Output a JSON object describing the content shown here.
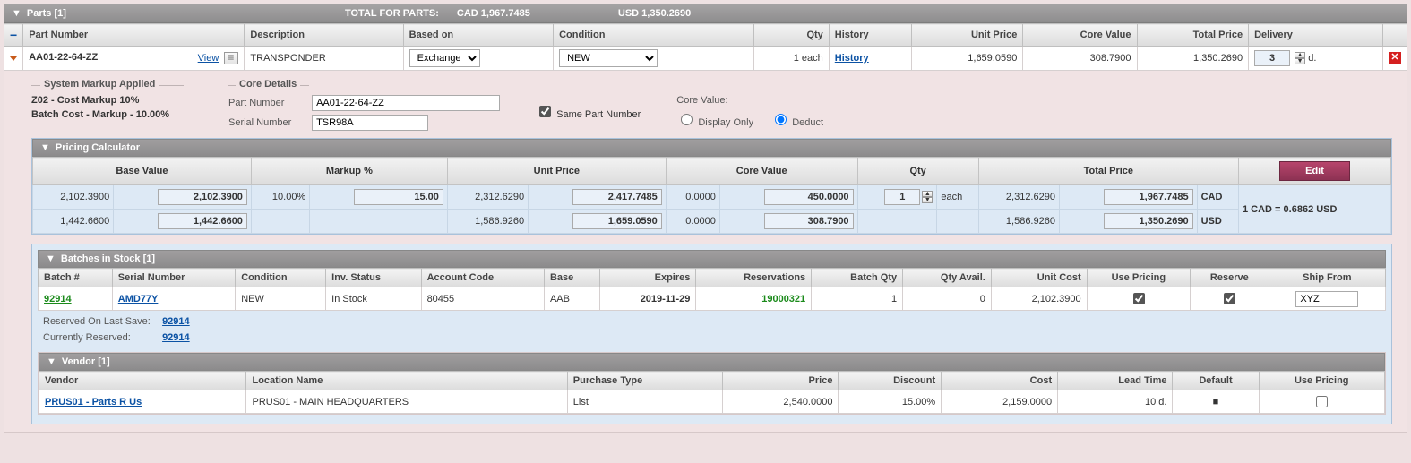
{
  "parts_header": {
    "title": "Parts [1]",
    "total_label": "TOTAL FOR PARTS:",
    "total_cad": "CAD 1,967.7485",
    "total_usd": "USD 1,350.2690"
  },
  "grid_cols": {
    "pn": "Part Number",
    "desc": "Description",
    "based": "Based on",
    "cond": "Condition",
    "qty": "Qty",
    "hist": "History",
    "unit": "Unit Price",
    "core": "Core Value",
    "total": "Total Price",
    "deliv": "Delivery"
  },
  "part_row": {
    "pn": "AA01-22-64-ZZ",
    "view": "View",
    "desc": "TRANSPONDER",
    "based": "Exchange",
    "cond": "NEW",
    "qty": "1 each",
    "hist": "History",
    "unit": "1,659.0590",
    "core": "308.7900",
    "total": "1,350.2690",
    "deliv": "3",
    "deliv_unit": "d."
  },
  "markup": {
    "legend": "System Markup Applied",
    "l1": "Z02 - Cost Markup 10%",
    "l2": "Batch Cost - Markup - 10.00%"
  },
  "core_details": {
    "legend": "Core Details",
    "pn_lbl": "Part Number",
    "pn_val": "AA01-22-64-ZZ",
    "sn_lbl": "Serial Number",
    "sn_val": "TSR98A",
    "same": "Same Part Number",
    "cv_lbl": "Core Value:",
    "opt_display": "Display Only",
    "opt_deduct": "Deduct"
  },
  "calc": {
    "title": "Pricing Calculator",
    "cols": {
      "base": "Base Value",
      "markup": "Markup %",
      "unit": "Unit Price",
      "core": "Core Value",
      "qty": "Qty",
      "total": "Total Price"
    },
    "row1": {
      "base_txt": "2,102.3900",
      "base_in": "2,102.3900",
      "markup_txt": "10.00%",
      "markup_in": "15.00",
      "unit_txt": "2,312.6290",
      "unit_in": "2,417.7485",
      "core_txt": "0.0000",
      "core_in": "450.0000",
      "qty_in": "1",
      "qty_unit": "each",
      "total_txt": "2,312.6290",
      "total_in": "1,967.7485",
      "cur": "CAD"
    },
    "row2": {
      "base_txt": "1,442.6600",
      "base_in": "1,442.6600",
      "unit_txt": "1,586.9260",
      "unit_in": "1,659.0590",
      "core_txt": "0.0000",
      "core_in": "308.7900",
      "total_txt": "1,586.9260",
      "total_in": "1,350.2690",
      "cur": "USD"
    },
    "edit": "Edit",
    "rate": "1 CAD = 0.6862 USD"
  },
  "batches": {
    "title": "Batches in Stock [1]",
    "cols": {
      "batch": "Batch #",
      "sn": "Serial Number",
      "cond": "Condition",
      "inv": "Inv. Status",
      "acct": "Account Code",
      "base": "Base",
      "exp": "Expires",
      "res": "Reservations",
      "bqty": "Batch Qty",
      "avail": "Qty Avail.",
      "ucost": "Unit Cost",
      "usep": "Use Pricing",
      "reserve": "Reserve",
      "ship": "Ship From"
    },
    "row": {
      "batch": "92914",
      "sn": "AMD77Y",
      "cond": "NEW",
      "inv": "In Stock",
      "acct": "80455",
      "base": "AAB",
      "exp": "2019-11-29",
      "res": "19000321",
      "bqty": "1",
      "avail": "0",
      "ucost": "2,102.3900",
      "ship": "XYZ"
    },
    "reserved_lbl": "Reserved On Last Save:",
    "reserved_val": "92914",
    "current_lbl": "Currently Reserved:",
    "current_val": "92914"
  },
  "vendor": {
    "title": "Vendor [1]",
    "cols": {
      "vendor": "Vendor",
      "loc": "Location Name",
      "ptype": "Purchase Type",
      "price": "Price",
      "disc": "Discount",
      "cost": "Cost",
      "lead": "Lead Time",
      "def": "Default",
      "usep": "Use Pricing"
    },
    "row": {
      "vendor": "PRUS01 - Parts R Us",
      "loc": "PRUS01 - MAIN HEADQUARTERS",
      "ptype": "List",
      "price": "2,540.0000",
      "disc": "15.00%",
      "cost": "2,159.0000",
      "lead": "10 d."
    }
  }
}
